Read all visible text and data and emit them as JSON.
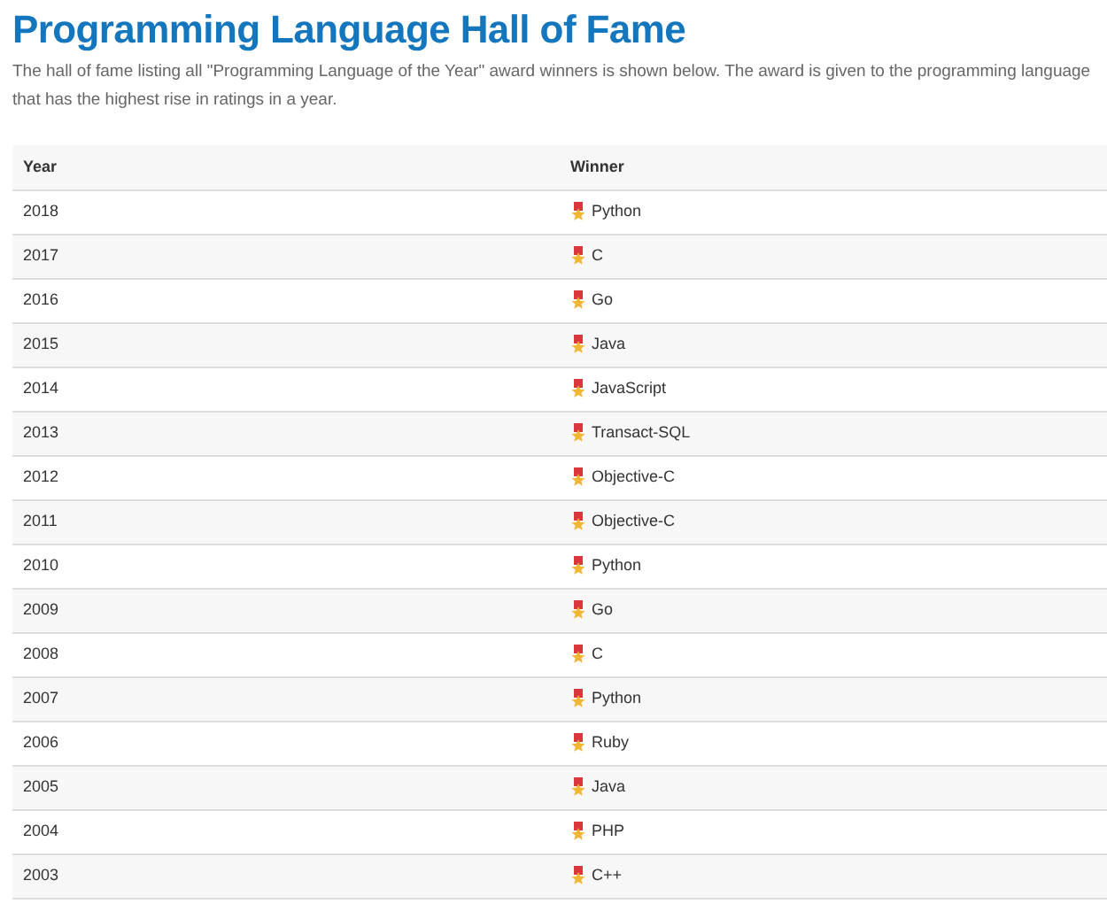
{
  "title": "Programming Language Hall of Fame",
  "description": "The hall of fame listing all \"Programming Language of the Year\" award winners is shown below. The award is given to the programming language that has the highest rise in ratings in a year.",
  "table": {
    "columns": [
      "Year",
      "Winner"
    ],
    "rows": [
      {
        "year": "2018",
        "winner": "Python"
      },
      {
        "year": "2017",
        "winner": "C"
      },
      {
        "year": "2016",
        "winner": "Go"
      },
      {
        "year": "2015",
        "winner": "Java"
      },
      {
        "year": "2014",
        "winner": "JavaScript"
      },
      {
        "year": "2013",
        "winner": "Transact-SQL"
      },
      {
        "year": "2012",
        "winner": "Objective-C"
      },
      {
        "year": "2011",
        "winner": "Objective-C"
      },
      {
        "year": "2010",
        "winner": "Python"
      },
      {
        "year": "2009",
        "winner": "Go"
      },
      {
        "year": "2008",
        "winner": "C"
      },
      {
        "year": "2007",
        "winner": "Python"
      },
      {
        "year": "2006",
        "winner": "Ruby"
      },
      {
        "year": "2005",
        "winner": "Java"
      },
      {
        "year": "2004",
        "winner": "PHP"
      },
      {
        "year": "2003",
        "winner": "C++"
      }
    ]
  }
}
